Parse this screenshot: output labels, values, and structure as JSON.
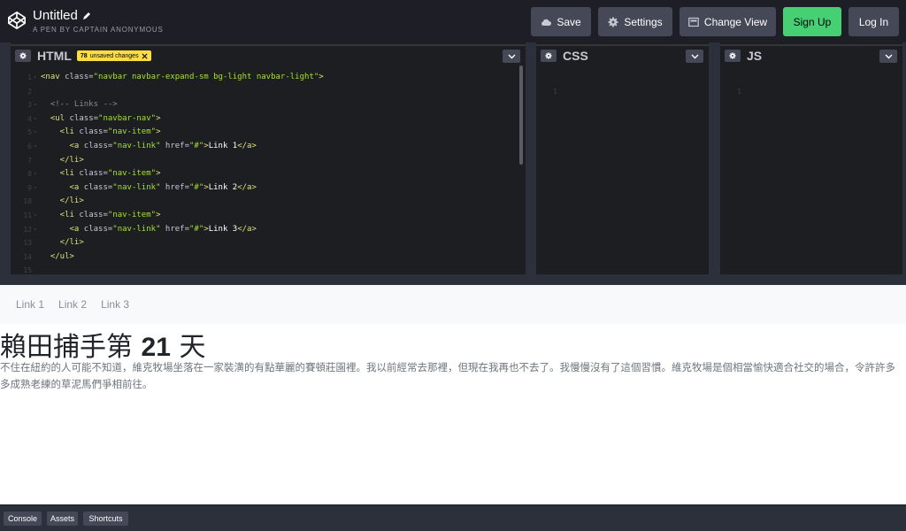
{
  "header": {
    "title": "Untitled",
    "author": "A PEN BY CAPTAIN ANONYMOUS",
    "buttons": {
      "save": "Save",
      "settings": "Settings",
      "change_view": "Change View",
      "sign_up": "Sign Up",
      "log_in": "Log In"
    }
  },
  "editors": {
    "html": {
      "name": "HTML",
      "unsaved_count": "78",
      "unsaved_text": "unsaved changes",
      "lines": [
        {
          "n": "1",
          "fold": "▾",
          "parts": [
            [
              "t-tag",
              "<nav "
            ],
            [
              "t-attr",
              "class="
            ],
            [
              "t-str",
              "\"navbar navbar-expand-sm bg-light navbar-light\""
            ],
            [
              "t-tag",
              ">"
            ]
          ]
        },
        {
          "n": "2",
          "fold": "",
          "parts": []
        },
        {
          "n": "3",
          "fold": "▾",
          "parts": [
            [
              "t-cmt",
              "  <!-- Links -->"
            ]
          ]
        },
        {
          "n": "4",
          "fold": "▾",
          "parts": [
            [
              "t-tag",
              "  <ul "
            ],
            [
              "t-attr",
              "class="
            ],
            [
              "t-str",
              "\"navbar-nav\""
            ],
            [
              "t-tag",
              ">"
            ]
          ]
        },
        {
          "n": "5",
          "fold": "▾",
          "parts": [
            [
              "t-tag",
              "    <li "
            ],
            [
              "t-attr",
              "class="
            ],
            [
              "t-str",
              "\"nav-item\""
            ],
            [
              "t-tag",
              ">"
            ]
          ]
        },
        {
          "n": "6",
          "fold": "▾",
          "parts": [
            [
              "t-tag",
              "      <a "
            ],
            [
              "t-attr",
              "class="
            ],
            [
              "t-str",
              "\"nav-link\""
            ],
            [
              "t-attr",
              " href="
            ],
            [
              "t-str",
              "\"#\""
            ],
            [
              "t-tag",
              ">"
            ],
            [
              "t-txt",
              "Link 1"
            ],
            [
              "t-tag",
              "</a>"
            ]
          ]
        },
        {
          "n": "7",
          "fold": "",
          "parts": [
            [
              "t-tag",
              "    </li>"
            ]
          ]
        },
        {
          "n": "8",
          "fold": "▾",
          "parts": [
            [
              "t-tag",
              "    <li "
            ],
            [
              "t-attr",
              "class="
            ],
            [
              "t-str",
              "\"nav-item\""
            ],
            [
              "t-tag",
              ">"
            ]
          ]
        },
        {
          "n": "9",
          "fold": "▾",
          "parts": [
            [
              "t-tag",
              "      <a "
            ],
            [
              "t-attr",
              "class="
            ],
            [
              "t-str",
              "\"nav-link\""
            ],
            [
              "t-attr",
              " href="
            ],
            [
              "t-str",
              "\"#\""
            ],
            [
              "t-tag",
              ">"
            ],
            [
              "t-txt",
              "Link 2"
            ],
            [
              "t-tag",
              "</a>"
            ]
          ]
        },
        {
          "n": "10",
          "fold": "",
          "parts": [
            [
              "t-tag",
              "    </li>"
            ]
          ]
        },
        {
          "n": "11",
          "fold": "▾",
          "parts": [
            [
              "t-tag",
              "    <li "
            ],
            [
              "t-attr",
              "class="
            ],
            [
              "t-str",
              "\"nav-item\""
            ],
            [
              "t-tag",
              ">"
            ]
          ]
        },
        {
          "n": "12",
          "fold": "▾",
          "parts": [
            [
              "t-tag",
              "      <a "
            ],
            [
              "t-attr",
              "class="
            ],
            [
              "t-str",
              "\"nav-link\""
            ],
            [
              "t-attr",
              " href="
            ],
            [
              "t-str",
              "\"#\""
            ],
            [
              "t-tag",
              ">"
            ],
            [
              "t-txt",
              "Link 3"
            ],
            [
              "t-tag",
              "</a>"
            ]
          ]
        },
        {
          "n": "13",
          "fold": "",
          "parts": [
            [
              "t-tag",
              "    </li>"
            ]
          ]
        },
        {
          "n": "14",
          "fold": "",
          "parts": [
            [
              "t-tag",
              "  </ul>"
            ]
          ]
        },
        {
          "n": "15",
          "fold": "",
          "parts": []
        }
      ]
    },
    "css": {
      "name": "CSS",
      "line_number": "1"
    },
    "js": {
      "name": "JS",
      "line_number": "1"
    }
  },
  "preview": {
    "nav_links": [
      "Link 1",
      "Link 2",
      "Link 3"
    ],
    "heading_pre": "賴田捕手第 ",
    "heading_num": "21",
    "heading_post": " 天",
    "paragraph": "不住在紐約的人可能不知道，維克牧場坐落在一家裝潢的有點華麗的賽頓莊園裡。我以前經常去那裡，但現在我再也不去了。我慢慢沒有了這個習慣。維克牧場是個相當愉快適合社交的場合，令許許多多成熟老練的草泥馬們爭相前往。"
  },
  "footer": {
    "console": "Console",
    "assets": "Assets",
    "shortcuts": "Shortcuts"
  },
  "colors": {
    "accent_green": "#47cf73",
    "unsaved_yellow": "#ffdd40",
    "button_gray": "#444857"
  }
}
